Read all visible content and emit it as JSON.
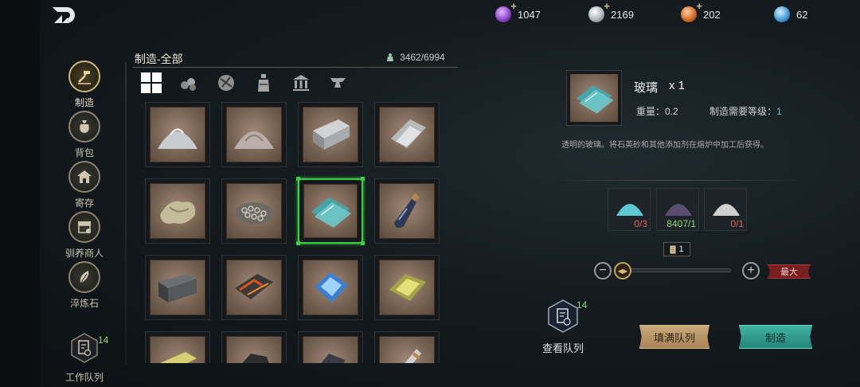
{
  "currencies": [
    {
      "value": "1047",
      "icon": "purple-orb-icon",
      "color": "#9b4fd1",
      "has_plus": true
    },
    {
      "value": "2169",
      "icon": "silver-coin-icon",
      "color": "#b0b7bc",
      "has_plus": true
    },
    {
      "value": "202",
      "icon": "copper-coin-icon",
      "color": "#d26a2a",
      "has_plus": true
    },
    {
      "value": "62",
      "icon": "blue-gem-icon",
      "color": "#4b9fd8",
      "has_plus": false
    }
  ],
  "sidebar": {
    "items": [
      {
        "label": "制造",
        "icon": "hammer-icon",
        "active": true
      },
      {
        "label": "背包",
        "icon": "bag-icon",
        "active": false
      },
      {
        "label": "寄存",
        "icon": "storehouse-icon",
        "active": false
      },
      {
        "label": "驯养商人",
        "icon": "merchant-icon",
        "active": false
      },
      {
        "label": "淬炼石",
        "icon": "feather-stone-icon",
        "active": false
      }
    ],
    "queue": {
      "label": "工作队列",
      "count": "14"
    }
  },
  "craft_panel": {
    "title": "制造-全部",
    "weight": "3462/6994",
    "tabs": [
      "grid-all-icon",
      "logs-icon",
      "ore-icon",
      "potion-icon",
      "building-icon",
      "anvil-icon"
    ]
  },
  "items": [
    {
      "name": "silver-powder-item"
    },
    {
      "name": "stone-powder-item"
    },
    {
      "name": "iron-ingot-item"
    },
    {
      "name": "metal-sheet-item"
    },
    {
      "name": "cloth-item"
    },
    {
      "name": "chainmail-item"
    },
    {
      "name": "glass-item"
    },
    {
      "name": "dark-flask-item"
    },
    {
      "name": "steel-ingot-item"
    },
    {
      "name": "magma-ingot-item"
    },
    {
      "name": "blue-crystal-item"
    },
    {
      "name": "gold-nugget-item"
    },
    {
      "name": "gold-bar-item"
    },
    {
      "name": "coal-item"
    },
    {
      "name": "dark-ore-item"
    },
    {
      "name": "dagger-item"
    }
  ],
  "detail": {
    "name": "玻璃",
    "qty": "x 1",
    "weight_label": "重量：0.2",
    "level_label": "制造需要等级：",
    "level_value": "1",
    "description": "透明的玻璃。将石英砂和其他添加剂在熔炉中加工后获得。"
  },
  "materials": [
    {
      "count": "0/3",
      "status": "red",
      "color": "#5fc7cf"
    },
    {
      "count": "8407/1",
      "status": "green",
      "color": "#5a4d6e"
    },
    {
      "count": "0/1",
      "status": "red",
      "color": "#cfcfcf"
    }
  ],
  "quantity": {
    "value": "1",
    "max_label": "最大",
    "minus": "−",
    "plus": "+"
  },
  "actions": {
    "view_queue_label": "查看队列",
    "queue_count": "14",
    "fill_queue_label": "填满队列",
    "craft_label": "制造"
  }
}
